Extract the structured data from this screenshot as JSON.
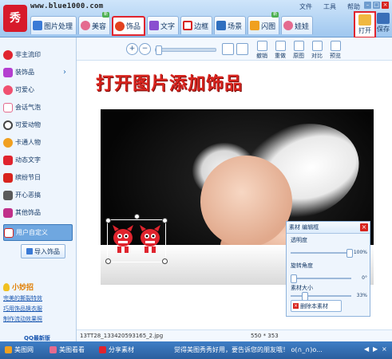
{
  "app": {
    "url_text": "www.blue1000.com",
    "logo_text": "秀"
  },
  "menu": [
    "文件",
    "工具",
    "帮助"
  ],
  "window_controls": [
    "–",
    "□",
    "×"
  ],
  "tabs": [
    {
      "label": "图片处理",
      "color": "#3a7ad6",
      "badge": ""
    },
    {
      "label": "美容",
      "color": "#e46b8f",
      "badge": "新"
    },
    {
      "label": "饰品",
      "color": "#e3421f",
      "badge": "",
      "active": true
    },
    {
      "label": "文字",
      "color": "#8a4fd0",
      "badge": ""
    },
    {
      "label": "边框",
      "color": "#d8241e",
      "badge": ""
    },
    {
      "label": "场景",
      "color": "#2f6fbf",
      "badge": ""
    },
    {
      "label": "闪图",
      "color": "#f0a020",
      "badge": "新"
    },
    {
      "label": "娃娃",
      "color": "#e46b8f",
      "badge": ""
    }
  ],
  "right_buttons": {
    "open": "打开",
    "save": "保存"
  },
  "sidebar": {
    "items": [
      {
        "label": "非主流印",
        "color": "#e0242e"
      },
      {
        "label": "装饰品",
        "color": "#b43fd0",
        "arrow": true
      },
      {
        "label": "可爱心",
        "color": "#f05070"
      },
      {
        "label": "会话气泡",
        "color": "#e46b8f"
      },
      {
        "label": "可爱动物",
        "color": "#444444"
      },
      {
        "label": "卡通人物",
        "color": "#f0a020"
      },
      {
        "label": "动态文字",
        "color": "#e0242e"
      },
      {
        "label": "缤纷节日",
        "color": "#d8241e"
      },
      {
        "label": "开心恶搞",
        "color": "#5a5a5a"
      },
      {
        "label": "其他饰品",
        "color": "#c0308a"
      },
      {
        "label": "用户自定义",
        "color": "#d8241e",
        "active": true
      }
    ],
    "import_button": "导入饰品",
    "tips": {
      "title": "小妙招",
      "links": [
        "完美的撕裂特效",
        "巧用饰品换衣服",
        "制作流动效果照"
      ]
    },
    "qq_new": "QQ最新版"
  },
  "toolbar": {
    "zoom_in": "+",
    "zoom_out": "−",
    "buttons": [
      "撤销",
      "重做",
      "原图",
      "对比",
      "预览"
    ]
  },
  "main": {
    "title": "打开图片添加饰品",
    "file_name": "13TT28_133420593165_2.jpg",
    "dimensions": "550 * 353"
  },
  "material_panel": {
    "tabs": "素材  编辑框",
    "transparency_label": "透明度",
    "transparency_value": "100%",
    "transparency_level": 1.0,
    "rotation_label": "旋转角度",
    "rotation_value": "0°",
    "rotation_level": 0.0,
    "size_label": "素材大小",
    "size_value": "33%",
    "size_level": 0.2,
    "delete_button": "删除本素材",
    "close": "×"
  },
  "statusbar": {
    "items": [
      "美图网",
      "美图看看",
      "分享素材"
    ],
    "message": "觉得美图秀秀好用，要告诉您的朋友哦！ o(∩_∩)o...",
    "controls": [
      "◀",
      "▶",
      "×"
    ]
  },
  "colors": {
    "accent_red": "#e0242e",
    "brand_blue": "#3e7ec6",
    "title_red": "#d8241e"
  }
}
